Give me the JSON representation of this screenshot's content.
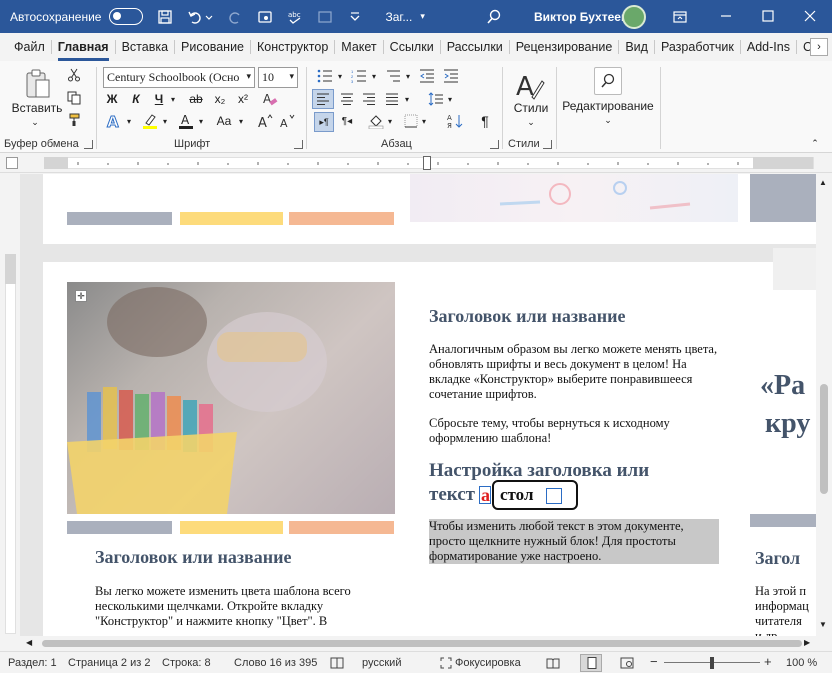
{
  "titlebar": {
    "autosave_label": "Автосохранение",
    "autosave_state": "off",
    "doc_title": "Заг...",
    "user_name": "Виктор Бухтеев",
    "bg_color": "#2b579a"
  },
  "menu": {
    "tabs": [
      "Файл",
      "Главная",
      "Вставка",
      "Рисование",
      "Конструктор",
      "Макет",
      "Ссылки",
      "Рассылки",
      "Рецензирование",
      "Вид",
      "Разработчик",
      "Add-Ins",
      "С"
    ],
    "active": "Главная"
  },
  "ribbon": {
    "clipboard": {
      "paste_label": "Вставить",
      "group_label": "Буфер обмена"
    },
    "font": {
      "font_name": "Century Schoolbook (Осно",
      "font_size": "10",
      "group_label": "Шрифт",
      "bold": "Ж",
      "italic": "К",
      "underline": "Ч",
      "strike": "ab",
      "sub": "x₂",
      "sup": "x²",
      "case": "Aa"
    },
    "paragraph": {
      "group_label": "Абзац"
    },
    "styles": {
      "label": "Стили",
      "group_label": "Стили"
    },
    "editing": {
      "label": "Редактирование"
    }
  },
  "document": {
    "left_heading": "Заголовок или название",
    "left_para": "Вы легко можете изменить цвета шаблона всего несколькими щелчками. Откройте вкладку \"Конструктор\" и нажмите кнопку \"Цвет\". В",
    "mid_heading1": "Заголовок или название",
    "mid_para1": "Аналогичным образом вы легко можете менять цвета, обновлять шрифты и весь документ в целом! На вкладке «Конструктор» выберите понравившееся сочетание шрифтов.",
    "mid_para2": "Сбросьте тему, чтобы вернуться к исходному оформлению шаблона!",
    "mid_heading2_line1": "Настройка заголовка или",
    "mid_heading2_line2": "текст",
    "autocorrect_wrong": "а",
    "autocorrect_word": "стол",
    "mid_para3": "Чтобы изменить любой текст в этом документе, просто щелкните нужный блок! Для простоты форматирование уже настроено.",
    "right_quote_line1": "«Ра",
    "right_quote_line2": "кру",
    "right_heading": "Загол",
    "right_para": "На этой п\nинформац\nчитателя\nи др",
    "bar_colors": [
      "#aab0bd",
      "#fddb7b",
      "#f5b893"
    ]
  },
  "status": {
    "section": "Раздел: 1",
    "page": "Страница 2 из 2",
    "line": "Строка: 8",
    "words": "Слово 16 из 395",
    "language": "русский",
    "focus": "Фокусировка",
    "zoom": "100 %",
    "zoom_level": 1.0
  }
}
